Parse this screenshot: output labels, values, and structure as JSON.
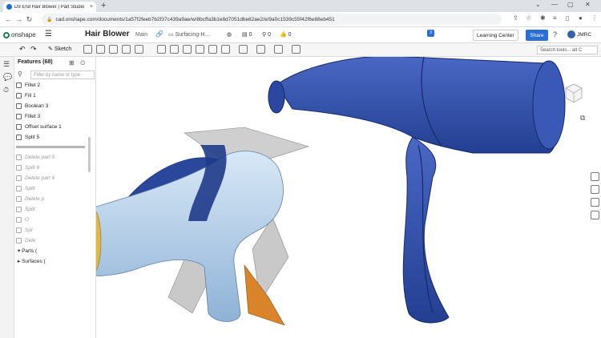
{
  "browser": {
    "tab_title": "D9 End Hair Blower | Part Studio",
    "tab_close": "×",
    "new_tab": "+",
    "url": "cad.onshape.com/documents/1a57f2feeb7b2f37c439a9ae/w/8bcffa3b1e8d7051dbe82ae2/e/9a0c1539c55f42f6e88eb451",
    "window_controls": [
      "⌄",
      "—",
      "▢",
      "✕"
    ]
  },
  "onshape": {
    "logo_text": "onshape",
    "doc_name": "Hair Blower",
    "branch": "Main",
    "tab_name": "Surfacing-H...",
    "counters": [
      "0",
      "0",
      "0"
    ],
    "learning_center": "Learning Center",
    "share": "Share",
    "user": "JMRC",
    "sketch_label": "Sketch",
    "search_tools": "Search tools...  alt C",
    "notification_count": "3"
  },
  "features": {
    "header": "Features (68)",
    "filter_placeholder": "Filter by name or type",
    "items": [
      {
        "label": "Fillet 2",
        "suppressed": false
      },
      {
        "label": "Fill 1",
        "suppressed": false
      },
      {
        "label": "Boolean 3",
        "suppressed": false
      },
      {
        "label": "Fillet 3",
        "suppressed": false
      },
      {
        "label": "Offset surface 1",
        "suppressed": false
      },
      {
        "label": "Split 5",
        "suppressed": false
      },
      {
        "label": "Delete part 5",
        "suppressed": true
      },
      {
        "label": "Split 6",
        "suppressed": true
      },
      {
        "label": "Delete part 6",
        "suppressed": true
      },
      {
        "label": "Split",
        "suppressed": true
      },
      {
        "label": "Delete p",
        "suppressed": true
      },
      {
        "label": "Split",
        "suppressed": true
      },
      {
        "label": "O",
        "suppressed": true
      },
      {
        "label": "Spl",
        "suppressed": true
      },
      {
        "label": "Dele",
        "suppressed": true
      }
    ],
    "parts_label": "Parts (",
    "surfaces_label": "Surfaces ("
  },
  "colors": {
    "accent": "#2a6fd6",
    "blower_blue": "#2f4fa8",
    "surface_light": "#b9d3ec",
    "surface_dark_blue": "#1f3a8a",
    "surface_grey": "#c9c9c9",
    "surface_orange": "#d9832a"
  },
  "icons": {
    "back": "arrow-left-icon",
    "forward": "arrow-right-icon",
    "reload": "reload-icon",
    "lock": "lock-icon",
    "menu": "hamburger-icon",
    "link": "link-icon",
    "help": "help-icon",
    "view_cube": "view-cube-icon"
  }
}
